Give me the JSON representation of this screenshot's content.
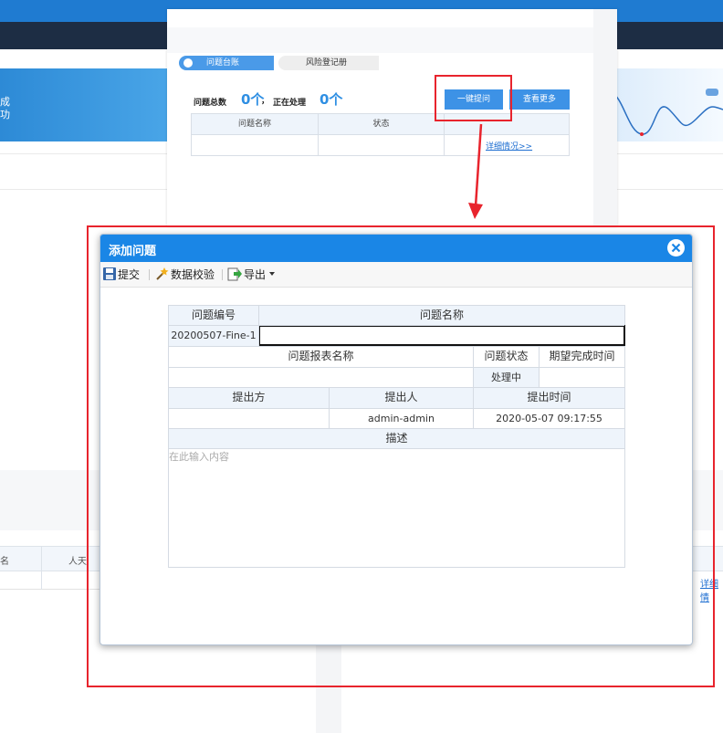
{
  "background": {
    "hero_left_text": [
      "成",
      "功"
    ],
    "grid_headers": [
      "名",
      "人天"
    ],
    "right_link": "详细情"
  },
  "card": {
    "tabs": [
      {
        "label": "问题台账",
        "active": true
      },
      {
        "label": "风险登记册",
        "active": false
      }
    ],
    "stats": {
      "total_label": "问题总数",
      "total_value": "0个",
      "separator": "，",
      "processing_label": "正在处理",
      "processing_value": "0个"
    },
    "buttons": {
      "quick_ask": "一键提问",
      "view_more": "查看更多"
    },
    "table": {
      "headers": [
        "问题名称",
        "状态",
        ""
      ],
      "detail_link": "详细情况>>"
    }
  },
  "modal": {
    "title": "添加问题",
    "toolbar": {
      "submit": "提交",
      "validate": "数据校验",
      "export": "导出"
    },
    "form": {
      "labels": {
        "issue_no": "问题编号",
        "issue_name": "问题名称",
        "report_name": "问题报表名称",
        "status": "问题状态",
        "expected_date": "期望完成时间",
        "proposer_party": "提出方",
        "proposer": "提出人",
        "proposed_time": "提出时间",
        "description": "描述"
      },
      "values": {
        "issue_no": "20200507-Fine-1",
        "issue_name": "",
        "report_name": "",
        "status": "处理中",
        "expected_date": "",
        "proposer_party": "",
        "proposer": "admin-admin",
        "proposed_time": "2020-05-07 09:17:55"
      },
      "description_placeholder": "在此输入内容"
    }
  },
  "colors": {
    "accent": "#1a86e6",
    "highlight": "#e8242d",
    "stat_value": "#2f8fe3"
  }
}
